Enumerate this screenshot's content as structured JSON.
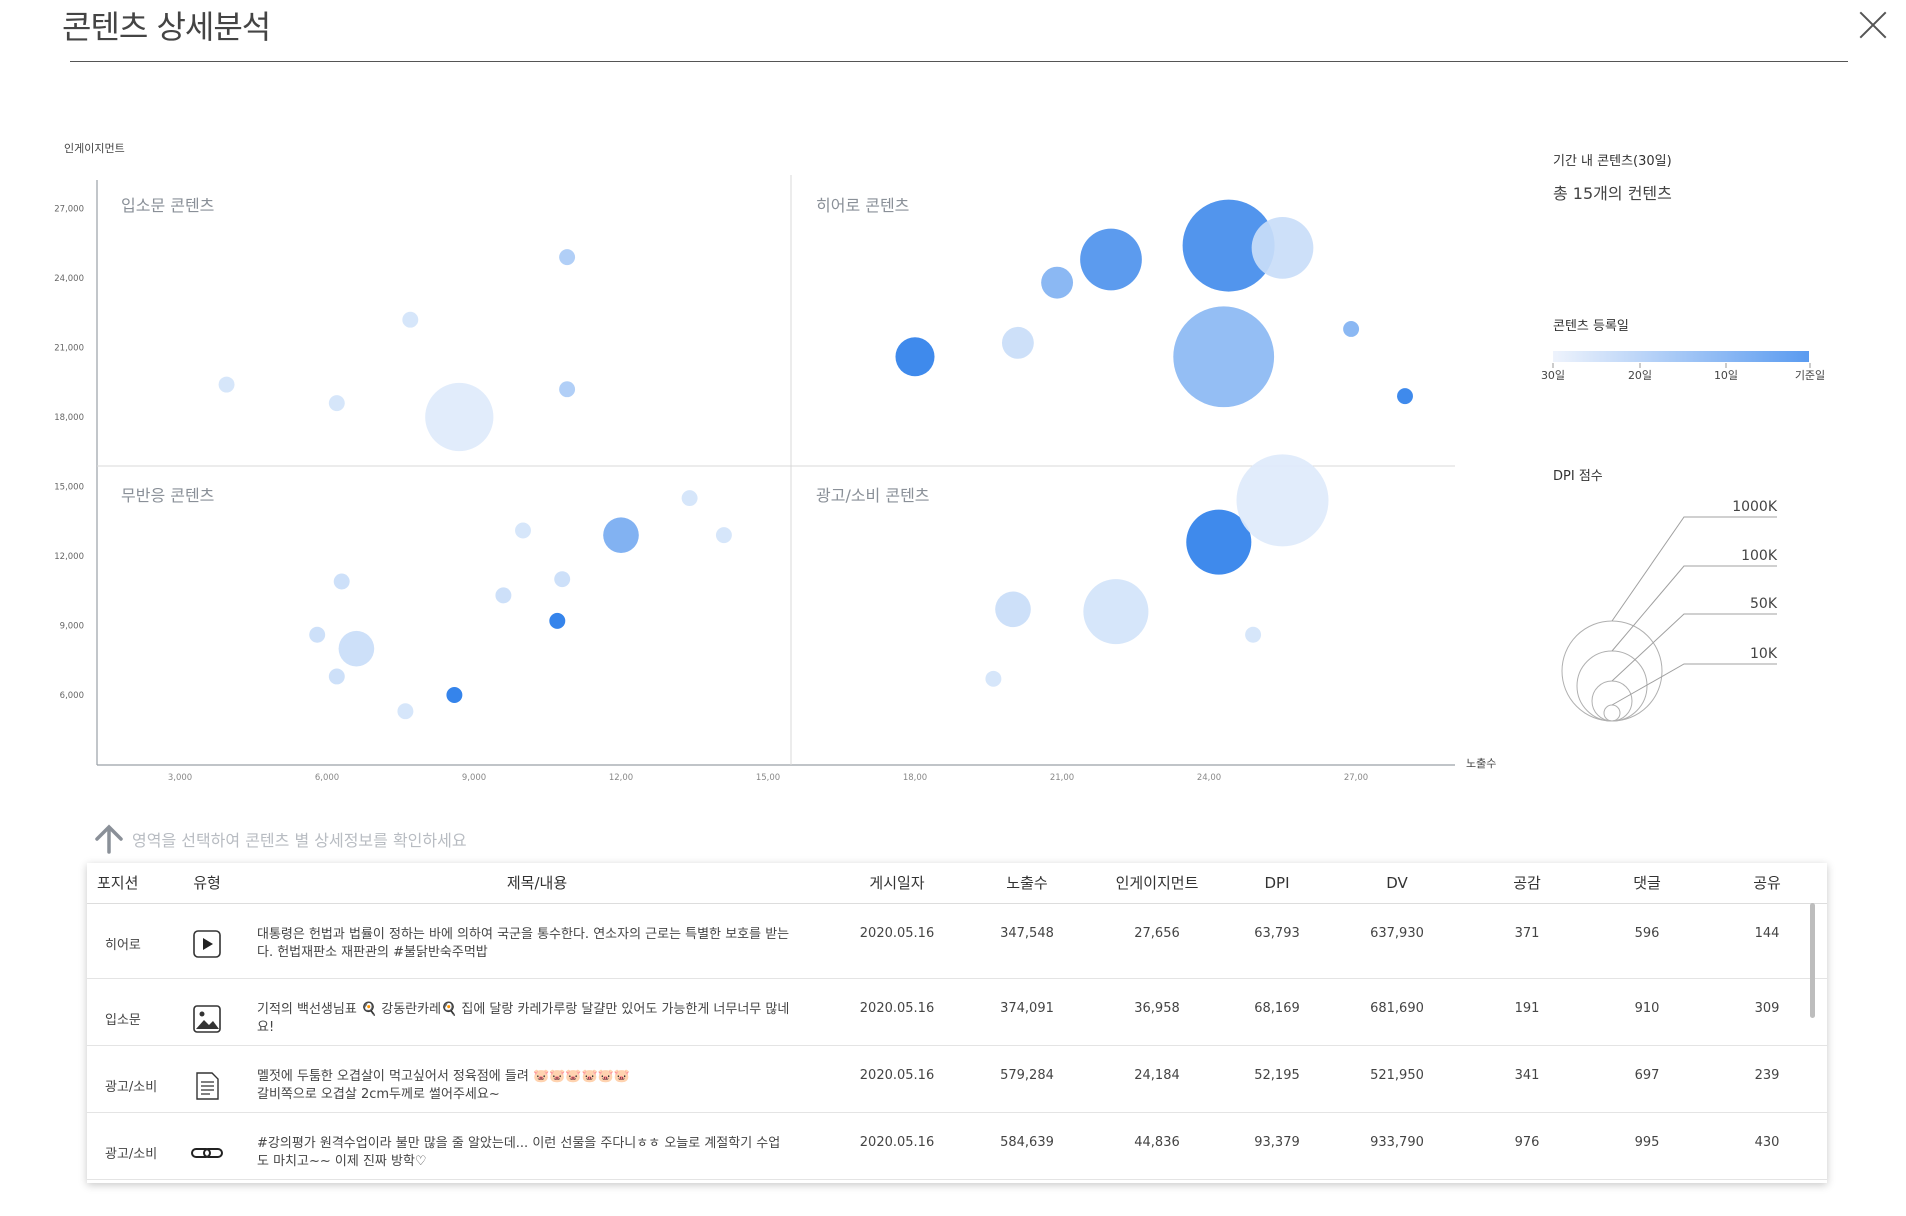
{
  "header": {
    "title": "콘텐츠 상세분석"
  },
  "chart_data": {
    "type": "scatter",
    "ylabel": "인게이지먼트",
    "xlabel": "노출수",
    "x_ticks": [
      "3,000",
      "6,000",
      "9,000",
      "12,00",
      "15,00",
      "18,00",
      "21,00",
      "24,00",
      "27,00"
    ],
    "y_ticks": [
      "6,000",
      "9,000",
      "12,000",
      "15,000",
      "18,000",
      "21,000",
      "24,000",
      "27,000"
    ],
    "quadrants": [
      "입소문 콘텐츠",
      "히어로 콘텐츠",
      "무반응 콘텐츠",
      "광고/소비 콘텐츠"
    ],
    "points": [
      {
        "x": 3950,
        "y": 19400,
        "size": 3,
        "age": 0.9
      },
      {
        "x": 6200,
        "y": 18600,
        "size": 3,
        "age": 0.9
      },
      {
        "x": 7700,
        "y": 22200,
        "size": 3,
        "age": 0.9
      },
      {
        "x": 8700,
        "y": 18000,
        "size": 55,
        "age": 0.95
      },
      {
        "x": 10900,
        "y": 24900,
        "size": 3,
        "age": 0.7
      },
      {
        "x": 10900,
        "y": 19200,
        "size": 3,
        "age": 0.7
      },
      {
        "x": 18000,
        "y": 20600,
        "size": 18,
        "age": 0.1
      },
      {
        "x": 20100,
        "y": 21200,
        "size": 12,
        "age": 0.85
      },
      {
        "x": 20900,
        "y": 23800,
        "size": 12,
        "age": 0.5
      },
      {
        "x": 22000,
        "y": 24800,
        "size": 45,
        "age": 0.25
      },
      {
        "x": 24300,
        "y": 20600,
        "size": 120,
        "age": 0.55
      },
      {
        "x": 24400,
        "y": 25400,
        "size": 100,
        "age": 0.2
      },
      {
        "x": 25500,
        "y": 25300,
        "size": 45,
        "age": 0.85
      },
      {
        "x": 26900,
        "y": 21800,
        "size": 3,
        "age": 0.5
      },
      {
        "x": 28000,
        "y": 18900,
        "size": 3,
        "age": 0.1
      },
      {
        "x": 5800,
        "y": 8600,
        "size": 3,
        "age": 0.85
      },
      {
        "x": 6200,
        "y": 6800,
        "size": 3,
        "age": 0.85
      },
      {
        "x": 6300,
        "y": 10900,
        "size": 3,
        "age": 0.85
      },
      {
        "x": 6600,
        "y": 8000,
        "size": 15,
        "age": 0.85
      },
      {
        "x": 7600,
        "y": 5300,
        "size": 3,
        "age": 0.9
      },
      {
        "x": 8600,
        "y": 6000,
        "size": 3,
        "age": 0.05
      },
      {
        "x": 9600,
        "y": 10300,
        "size": 3,
        "age": 0.85
      },
      {
        "x": 10000,
        "y": 13100,
        "size": 3,
        "age": 0.9
      },
      {
        "x": 10700,
        "y": 9200,
        "size": 3,
        "age": 0.05
      },
      {
        "x": 10800,
        "y": 11000,
        "size": 3,
        "age": 0.85
      },
      {
        "x": 12000,
        "y": 12900,
        "size": 15,
        "age": 0.45
      },
      {
        "x": 13400,
        "y": 14500,
        "size": 3,
        "age": 0.9
      },
      {
        "x": 14100,
        "y": 12900,
        "size": 3,
        "age": 0.9
      },
      {
        "x": 19600,
        "y": 6700,
        "size": 3,
        "age": 0.9
      },
      {
        "x": 20000,
        "y": 9700,
        "size": 15,
        "age": 0.85
      },
      {
        "x": 22100,
        "y": 9600,
        "size": 50,
        "age": 0.9
      },
      {
        "x": 24200,
        "y": 12600,
        "size": 50,
        "age": 0.1
      },
      {
        "x": 25500,
        "y": 14400,
        "size": 100,
        "age": 0.95
      },
      {
        "x": 24900,
        "y": 8600,
        "size": 3,
        "age": 0.9
      }
    ]
  },
  "side": {
    "period_label": "기간 내 콘텐츠(30일)",
    "total_text": "총 15개의 컨텐츠",
    "date_legend_title": "콘텐츠 등록일",
    "date_legend_ticks": [
      "30일",
      "20일",
      "10일",
      "기준일"
    ],
    "dpi_title": "DPI 점수",
    "dpi_levels": [
      "1000K",
      "100K",
      "50K",
      "10K"
    ]
  },
  "hint": "영역을 선택하여 콘텐츠 별 상세정보를 확인하세요",
  "table": {
    "headers": [
      "포지션",
      "유형",
      "제목/내용",
      "게시일자",
      "노출수",
      "인게이지먼트",
      "DPI",
      "DV",
      "공감",
      "댓글",
      "공유"
    ],
    "rows": [
      {
        "position": "히어로",
        "type_icon": "play-icon",
        "content_1": "대통령은 헌법과 법률이 정하는 바에 의하여 국군을 통수한다. 연소자의 근로는 특별한 보호를 받는",
        "content_2": "다. 헌법재판소 재판관의 #불닭반숙주먹밥",
        "date": "2020.05.16",
        "impressions": "347,548",
        "engagement": "27,656",
        "dpi": "63,793",
        "dv": "637,930",
        "likes": "371",
        "comments": "596",
        "shares": "144"
      },
      {
        "position": "입소문",
        "type_icon": "image-icon",
        "content_1": "기적의 백선생님표 🍳 강동란카레🍳 집에 달랑 카레가루랑 달걀만 있어도 가능한게 너무너무 많네",
        "content_2": "요!",
        "date": "2020.05.16",
        "impressions": "374,091",
        "engagement": "36,958",
        "dpi": "68,169",
        "dv": "681,690",
        "likes": "191",
        "comments": "910",
        "shares": "309"
      },
      {
        "position": "광고/소비",
        "type_icon": "document-icon",
        "content_1": "멜젓에 두툼한 오겹살이 먹고싶어서 정육점에 들려 🐷🐷🐷🐷🐷🐷",
        "content_2": "갈비쪽으로 오겹살 2cm두께로 썰어주세요~",
        "date": "2020.05.16",
        "impressions": "579,284",
        "engagement": "24,184",
        "dpi": "52,195",
        "dv": "521,950",
        "likes": "341",
        "comments": "697",
        "shares": "239"
      },
      {
        "position": "광고/소비",
        "type_icon": "link-icon",
        "content_1": "#강의평가 원격수업이라 불만 많을 줄 알았는데... 이런 선물을 주다니ㅎㅎ 오늘로 계절학기 수업",
        "content_2": "도 마치고~~ 이제 진짜 방학♡",
        "date": "2020.05.16",
        "impressions": "584,639",
        "engagement": "44,836",
        "dpi": "93,379",
        "dv": "933,790",
        "likes": "976",
        "comments": "995",
        "shares": "430"
      }
    ]
  },
  "colors": {
    "accent": "#1a73e8",
    "light": "#e7effb",
    "gridline": "#d9d9d9"
  }
}
